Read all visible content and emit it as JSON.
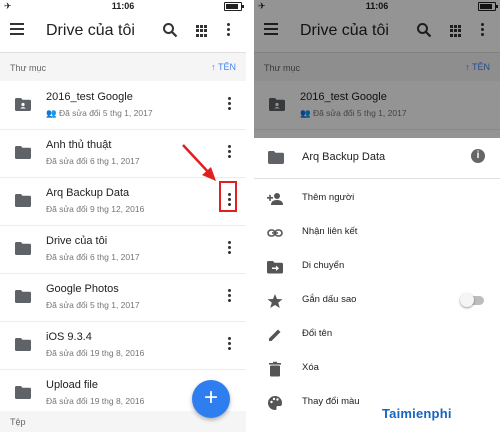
{
  "status": {
    "carrier": "✈",
    "time": "11:06"
  },
  "left": {
    "title": "Drive của tôi",
    "section_label": "Thư mục",
    "sort_label": "↑ TÊN",
    "items": [
      {
        "name": "2016_test Google",
        "sub": "Đã sửa đổi 5 thg 1, 2017"
      },
      {
        "name": "Anh thủ thuật",
        "sub": "Đã sửa đổi 6 thg 1, 2017"
      },
      {
        "name": "Arq Backup Data",
        "sub": "Đã sửa đổi 9 thg 12, 2016"
      },
      {
        "name": "Drive của tôi",
        "sub": "Đã sửa đổi 6 thg 1, 2017"
      },
      {
        "name": "Google Photos",
        "sub": "Đã sửa đổi 5 thg 1, 2017"
      },
      {
        "name": "iOS 9.3.4",
        "sub": "Đã sửa đổi 19 thg 8, 2016"
      },
      {
        "name": "Upload file",
        "sub": "Đã sửa đổi 19 thg 8, 2016"
      }
    ],
    "files_label": "Tệp",
    "fab": "+"
  },
  "right": {
    "title": "Drive của tôi",
    "section_label": "Thư mục",
    "sort_label": "↑ TÊN",
    "peek_item": {
      "name": "2016_test Google",
      "sub": "Đã sửa đổi 5 thg 1, 2017"
    },
    "sheet_title": "Arq Backup Data",
    "info_icon": "i",
    "options": [
      {
        "label": "Thêm người",
        "icon": "add-person-icon"
      },
      {
        "label": "Nhận liên kết",
        "icon": "link-icon"
      },
      {
        "label": "Di chuyển",
        "icon": "move-icon"
      },
      {
        "label": "Gắn dấu sao",
        "icon": "star-icon"
      },
      {
        "label": "Đổi tên",
        "icon": "edit-icon"
      },
      {
        "label": "Xóa",
        "icon": "delete-icon"
      },
      {
        "label": "Thay đổi màu",
        "icon": "palette-icon"
      }
    ]
  },
  "watermark": "Taimienphi",
  "colors": {
    "accent": "#4285f4",
    "fab": "#2f7ef0",
    "highlight": "#e02020"
  }
}
